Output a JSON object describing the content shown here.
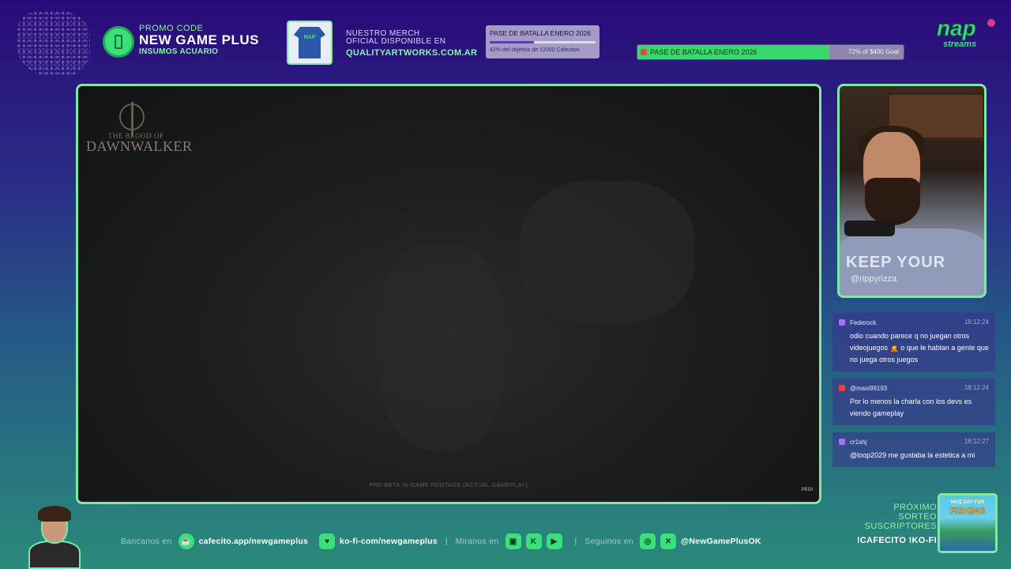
{
  "promo": {
    "label": "PROMO CODE",
    "code": "NEW GAME PLUS",
    "sub": "INSUMOS ACUARIO"
  },
  "merch": {
    "line1": "NUESTRO MERCH",
    "line2": "OFICIAL DISPONIBLE EN",
    "url": "QUALITYARTWORKS.COM.AR",
    "shirt_text": "NAP"
  },
  "goal_small": {
    "title": "PASE DE BATALLA ENERO 2026",
    "status": "42% del objetivo de 12000 Cafecitos",
    "progress": 0.42
  },
  "goal_bar": {
    "title": "PASE DE BATALLA ENERO 2026",
    "status": "72% of $400 Goal",
    "progress": 0.72
  },
  "brand": {
    "name": "nap",
    "sub": "streams"
  },
  "game": {
    "logo_small": "THE BLOOD OF",
    "logo_big": "DAWNWALKER",
    "footage_note": "PRE-BETA IN-GAME FOOTAGE (ACTUAL GAMEPLAY)",
    "rating": "PEGI"
  },
  "webcam": {
    "shirt_text": "KEEP YOUR",
    "handle": "@rippyrizza"
  },
  "chat": {
    "messages": [
      {
        "platform": "twitch",
        "platform_color": "#a970ff",
        "user": "Federock",
        "time": "18:12:24",
        "text": "odio cuando parece q no juegan otros videojuegos 🤦 o que le hablan a gente que no juega otros juegos"
      },
      {
        "platform": "youtube",
        "platform_color": "#ff3a3a",
        "user": "@maxi99193",
        "time": "18:12:24",
        "text": "Por lo menos la charla con los devs es viendo gameplay"
      },
      {
        "platform": "twitch",
        "platform_color": "#a970ff",
        "user": "cr1shj",
        "time": "18:12:27",
        "text": "@loop2029 me gustaba la estetica a mi"
      }
    ]
  },
  "sorteo": {
    "line1": "PRÓXIMO",
    "line2": "SORTEO",
    "line3": "SUSCRIPTORES",
    "commands": "!CAFECITO !KO-FI",
    "game_small": "NICE DAY FOR",
    "game_big": "FISHING"
  },
  "bottom": {
    "bancanos_label": "Bancanos en",
    "cafecito": "cafecito.app/newgameplus",
    "kofi": "ko-fi-com/newgameplus",
    "miranos_label": "Miranos en",
    "seguinos_label": "Seguinos en",
    "handle": "@NewGamePlusOK",
    "separator": "|"
  },
  "colors": {
    "accent": "#3ce07a",
    "frame": "#7fe7a8",
    "background_top": "#2a0a78",
    "background_bottom": "#2a8a7a"
  }
}
